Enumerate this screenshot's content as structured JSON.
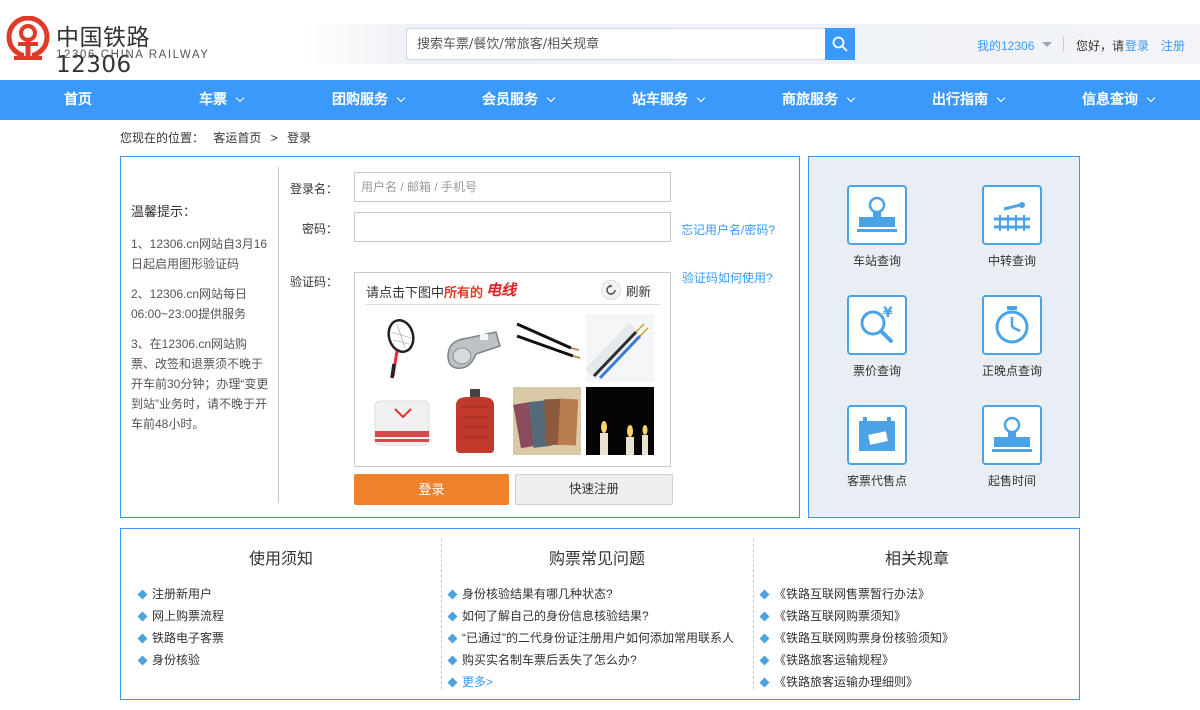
{
  "header": {
    "logo_cn": "中国铁路12306",
    "logo_en": "12306 CHINA RAILWAY",
    "search_placeholder": "搜索车票/餐饮/常旅客/相关规章",
    "my12306": "我的12306",
    "greeting": "您好，请",
    "login": "登录",
    "register": "注册"
  },
  "nav": {
    "items": [
      {
        "label": "首页",
        "has_dropdown": false
      },
      {
        "label": "车票",
        "has_dropdown": true
      },
      {
        "label": "团购服务",
        "has_dropdown": true
      },
      {
        "label": "会员服务",
        "has_dropdown": true
      },
      {
        "label": "站车服务",
        "has_dropdown": true
      },
      {
        "label": "商旅服务",
        "has_dropdown": true
      },
      {
        "label": "出行指南",
        "has_dropdown": true
      },
      {
        "label": "信息查询",
        "has_dropdown": true
      }
    ]
  },
  "breadcrumb": {
    "prefix": "您现在的位置：",
    "home": "客运首页",
    "sep": ">",
    "current": "登录"
  },
  "tips": {
    "title": "温馨提示：",
    "items": [
      "1、12306.cn网站自3月16日起启用图形验证码",
      "2、12306.cn网站每日06:00~23:00提供服务",
      "3、在12306.cn网站购票、改签和退票须不晚于开车前30分钟；办理“变更到站”业务时，请不晚于开车前48小时。"
    ]
  },
  "form": {
    "username_label": "登录名：",
    "username_placeholder": "用户名 / 邮箱 / 手机号",
    "password_label": "密码：",
    "forgot_link": "忘记用户名/密码?",
    "captcha_label": "验证码：",
    "captcha_help": "验证码如何使用?",
    "login_button": "登录",
    "quick_register_button": "快速注册"
  },
  "captcha": {
    "prompt_prefix": "请点击下图中",
    "prompt_highlight": "所有的",
    "target_word": "电线",
    "refresh": "刷新",
    "images": [
      "tennis-racket",
      "whistle",
      "electric-wire",
      "electric-wire",
      "headband",
      "hot-water-bottle",
      "leather-swatches",
      "candles"
    ]
  },
  "quick_links": [
    {
      "label": "车站查询",
      "icon": "station-icon"
    },
    {
      "label": "中转查询",
      "icon": "transfer-icon"
    },
    {
      "label": "票价查询",
      "icon": "fare-icon"
    },
    {
      "label": "正晚点查询",
      "icon": "clock-icon"
    },
    {
      "label": "客票代售点",
      "icon": "ticket-agent-icon"
    },
    {
      "label": "起售时间",
      "icon": "sale-time-icon"
    }
  ],
  "info": {
    "usage": {
      "title": "使用须知",
      "items": [
        "注册新用户",
        "网上购票流程",
        "铁路电子客票",
        "身份核验"
      ]
    },
    "faq": {
      "title": "购票常见问题",
      "items": [
        "身份核验结果有哪几种状态?",
        "如何了解自己的身份信息核验结果?",
        "“已通过”的二代身份证注册用户如何添加常用联系人",
        "购买实名制车票后丢失了怎么办?"
      ],
      "more": "更多>"
    },
    "rules": {
      "title": "相关规章",
      "items": [
        "《铁路互联网售票暂行办法》",
        "《铁路互联网购票须知》",
        "《铁路互联网购票身份核验须知》",
        "《铁路旅客运输规程》",
        "《铁路旅客运输办理细则》"
      ]
    }
  },
  "colors": {
    "primary": "#3b99fc",
    "login_button": "#f0812b",
    "logo_red": "#e03a2b"
  }
}
